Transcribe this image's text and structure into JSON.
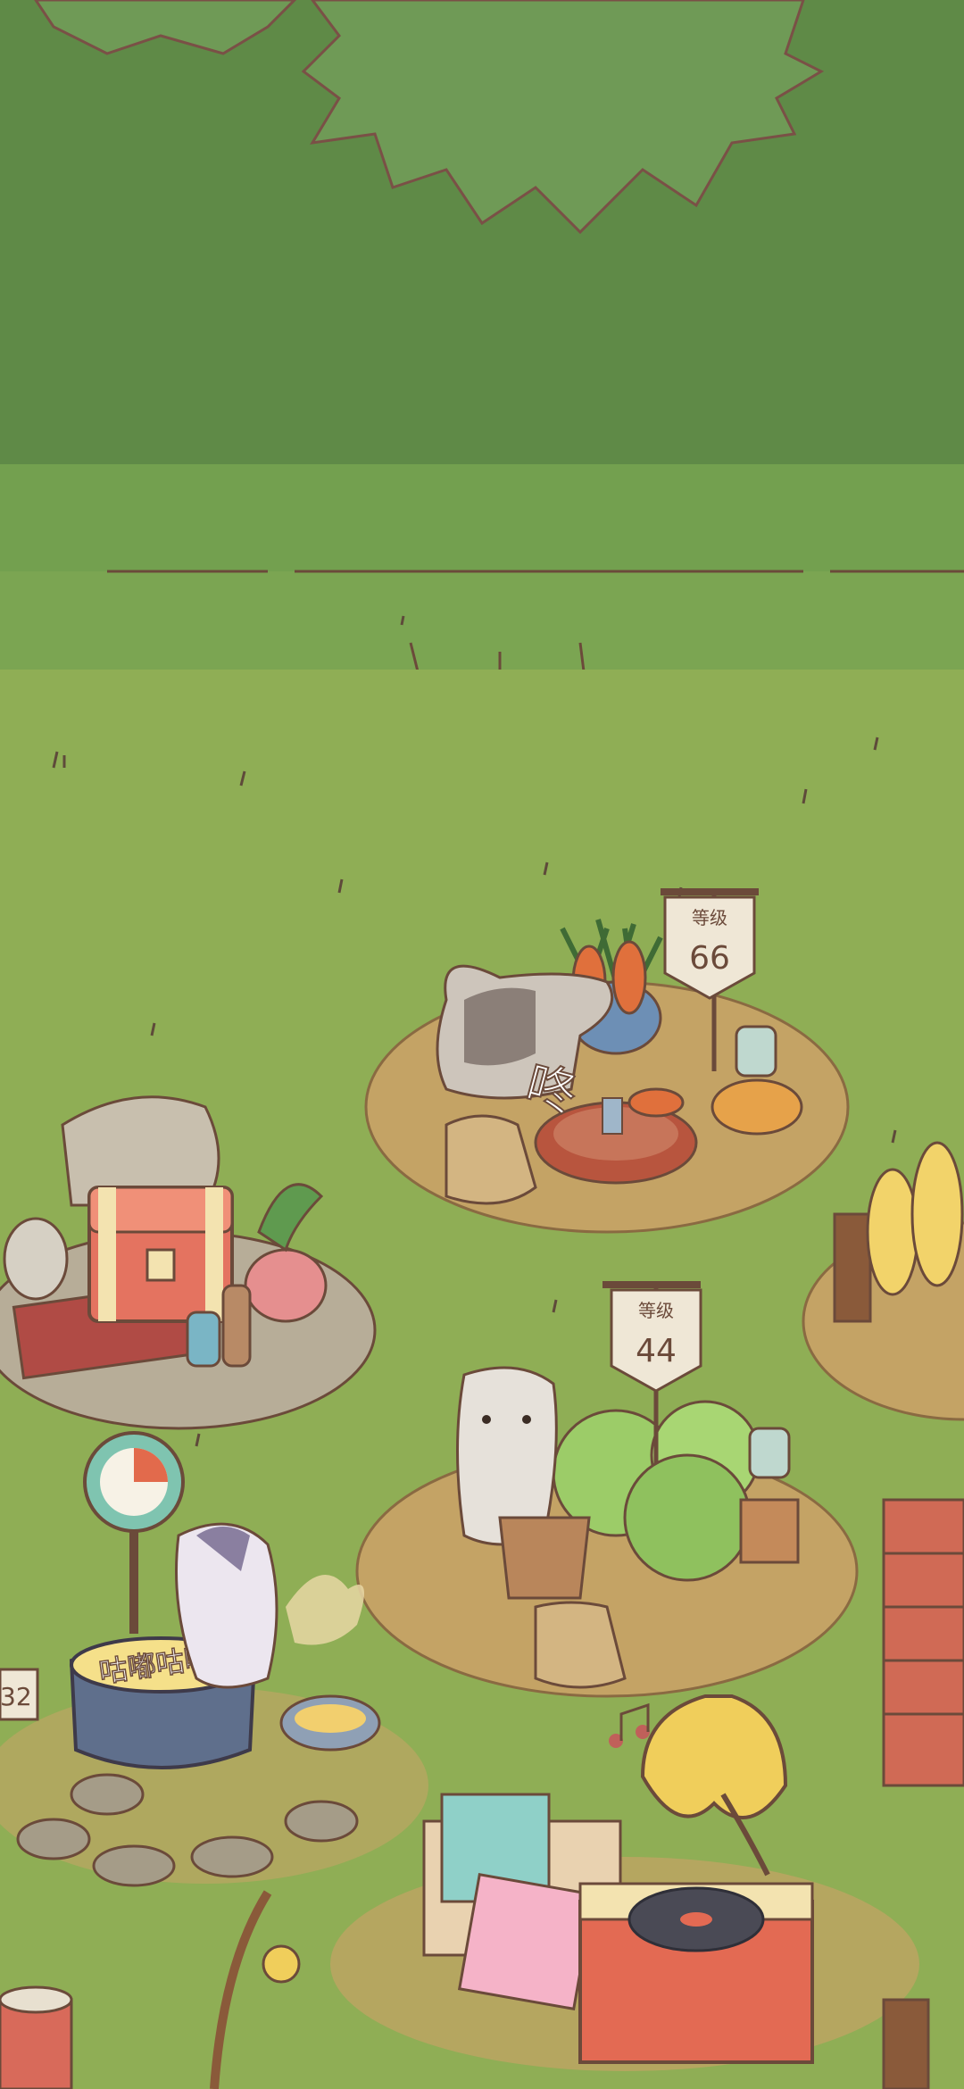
{
  "scene": {
    "title": "Cat farm / forest clearing",
    "colors": {
      "forest_dark": "#5f8a47",
      "forest_mid": "#6e9a52",
      "treeline": "#6f9a50",
      "grass": "#8fae55",
      "dirt": "#c4a365",
      "outline": "#6b4a3a"
    }
  },
  "stations": {
    "carrot": {
      "level_label": "等级",
      "level_value": "66",
      "sfx": "咚"
    },
    "cabbage": {
      "level_label": "等级",
      "level_value": "44"
    },
    "cooking": {
      "sfx": "咕嘟咕嘟",
      "partial_level": "32"
    }
  },
  "icons": [
    "treasure-chest-icon",
    "gramophone-icon",
    "lantern-icon",
    "cooking-pot-icon",
    "timer-gauge-icon",
    "vinyl-record-icon",
    "music-notes-icon",
    "cat-icon"
  ]
}
